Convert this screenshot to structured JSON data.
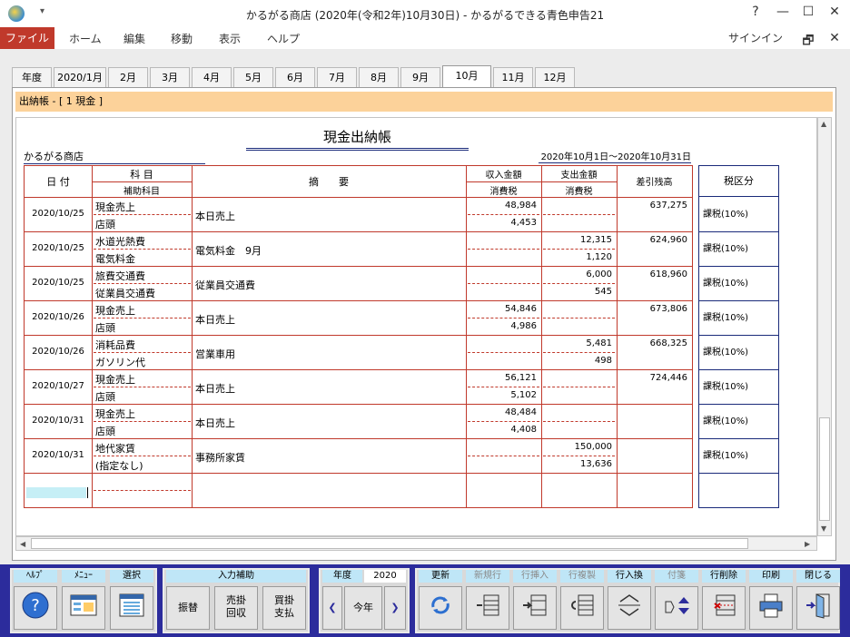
{
  "window": {
    "title": "かるがる商店 (2020年(令和2年)10月30日) - かるがるできる青色申告21",
    "help_icon": "?",
    "min_icon": "—",
    "max_icon": "☐",
    "close_icon": "✕"
  },
  "menu": {
    "file": "ファイル",
    "home": "ホーム",
    "edit": "編集",
    "move": "移動",
    "view": "表示",
    "help": "ヘルプ",
    "signin": "サインイン",
    "restore_icon": "🗗",
    "close2_icon": "✕"
  },
  "tabs": [
    "年度",
    "2020/1月",
    "2月",
    "3月",
    "4月",
    "5月",
    "6月",
    "7月",
    "8月",
    "9月",
    "10月",
    "11月",
    "12月"
  ],
  "active_tab": "10月",
  "ledger_label": "出納帳 - [ 1 現金 ]",
  "book": {
    "title": "現金出納帳",
    "shop": "かるがる商店",
    "period": "2020年10月1日～2020年10月31日"
  },
  "headers": {
    "date": "日 付",
    "account": "科 目",
    "sub_account": "補助科目",
    "description": "摘　　要",
    "income": "収入金額",
    "income_tax": "消費税",
    "expense": "支出金額",
    "expense_tax": "消費税",
    "balance": "差引残高",
    "tax_class": "税区分"
  },
  "rows": [
    {
      "date": "2020/10/25",
      "account": "現金売上",
      "sub": "店頭",
      "desc": "本日売上",
      "income": "48,984",
      "income_tax": "4,453",
      "expense": "",
      "expense_tax": "",
      "balance": "637,275",
      "tax": "課税(10%)"
    },
    {
      "date": "2020/10/25",
      "account": "水道光熱費",
      "sub": "電気料金",
      "desc": "電気料金　9月",
      "income": "",
      "income_tax": "",
      "expense": "12,315",
      "expense_tax": "1,120",
      "balance": "624,960",
      "tax": "課税(10%)"
    },
    {
      "date": "2020/10/25",
      "account": "旅費交通費",
      "sub": "従業員交通費",
      "desc": "従業員交通費",
      "income": "",
      "income_tax": "",
      "expense": "6,000",
      "expense_tax": "545",
      "balance": "618,960",
      "tax": "課税(10%)"
    },
    {
      "date": "2020/10/26",
      "account": "現金売上",
      "sub": "店頭",
      "desc": "本日売上",
      "income": "54,846",
      "income_tax": "4,986",
      "expense": "",
      "expense_tax": "",
      "balance": "673,806",
      "tax": "課税(10%)"
    },
    {
      "date": "2020/10/26",
      "account": "消耗品費",
      "sub": "ガソリン代",
      "desc": "営業車用",
      "income": "",
      "income_tax": "",
      "expense": "5,481",
      "expense_tax": "498",
      "balance": "668,325",
      "tax": "課税(10%)"
    },
    {
      "date": "2020/10/27",
      "account": "現金売上",
      "sub": "店頭",
      "desc": "本日売上",
      "income": "56,121",
      "income_tax": "5,102",
      "expense": "",
      "expense_tax": "",
      "balance": "724,446",
      "tax": "課税(10%)"
    },
    {
      "date": "2020/10/31",
      "account": "現金売上",
      "sub": "店頭",
      "desc": "本日売上",
      "income": "48,484",
      "income_tax": "4,408",
      "expense": "",
      "expense_tax": "",
      "balance": "",
      "tax": "課税(10%)"
    },
    {
      "date": "2020/10/31",
      "account": "地代家賃",
      "sub": "(指定なし)",
      "desc": "事務所家賃",
      "income": "",
      "income_tax": "",
      "expense": "150,000",
      "expense_tax": "13,636",
      "balance": "",
      "tax": "課税(10%)"
    }
  ],
  "toolbar": {
    "help": "ﾍﾙﾌﾟ",
    "menu": "ﾒﾆｭｰ",
    "select": "選択",
    "input_assist": "入力補助",
    "transfer": "振替",
    "receivable": "売掛\n回収",
    "payable": "買掛\n支払",
    "year_label": "年度",
    "year_value": "2020",
    "this_year": "今年",
    "refresh": "更新",
    "new_row": "新規行",
    "insert_row": "行挿入",
    "copy_row": "行複製",
    "swap_row": "行入換",
    "note": "付箋",
    "delete_row": "行削除",
    "print": "印刷",
    "close": "閉じる"
  },
  "colors": {
    "accent_red": "#c0392b",
    "navy": "#1a2a7a",
    "toolbar_bg": "#2c2c9c",
    "tab_label_bg": "#fcd29a"
  }
}
